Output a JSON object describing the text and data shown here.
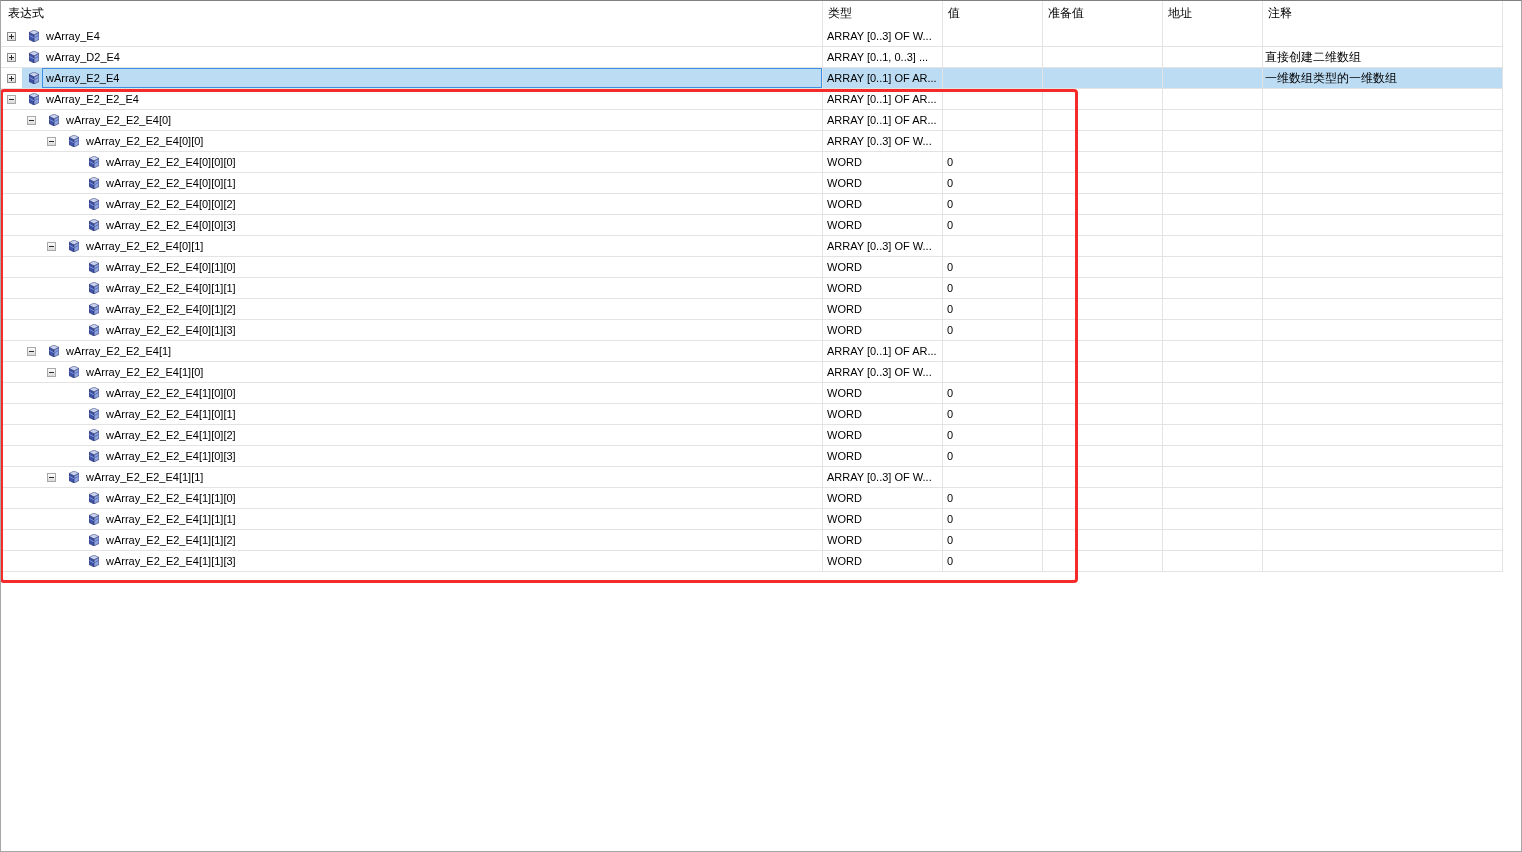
{
  "table": {
    "columns": [
      "表达式",
      "类型",
      "值",
      "准备值",
      "地址",
      "注释"
    ],
    "rows": [
      {
        "name": "wArray_E4",
        "type": "ARRAY [0..3] OF W...",
        "expanded": false,
        "selected": false
      },
      {
        "name": "wArray_D2_E4",
        "type": "ARRAY [0..1, 0..3] ...",
        "comment": "直接创建二维数组",
        "expanded": false,
        "selected": false
      },
      {
        "name": "wArray_E2_E4",
        "type": "ARRAY [0..1] OF AR...",
        "comment": "一维数组类型的一维数组",
        "expanded": false,
        "selected": true
      },
      {
        "name": "wArray_E2_E2_E4",
        "type": "ARRAY [0..1] OF AR...",
        "expanded": true,
        "selected": false,
        "children": [
          {
            "name": "wArray_E2_E2_E4[0]",
            "type": "ARRAY [0..1] OF AR...",
            "expanded": true,
            "selected": false,
            "children": [
              {
                "name": "wArray_E2_E2_E4[0][0]",
                "type": "ARRAY [0..3] OF W...",
                "expanded": true,
                "selected": false,
                "children": [
                  {
                    "name": "wArray_E2_E2_E4[0][0][0]",
                    "type": "WORD",
                    "value": "0",
                    "selected": false
                  },
                  {
                    "name": "wArray_E2_E2_E4[0][0][1]",
                    "type": "WORD",
                    "value": "0",
                    "selected": false
                  },
                  {
                    "name": "wArray_E2_E2_E4[0][0][2]",
                    "type": "WORD",
                    "value": "0",
                    "selected": false
                  },
                  {
                    "name": "wArray_E2_E2_E4[0][0][3]",
                    "type": "WORD",
                    "value": "0",
                    "selected": false
                  }
                ]
              },
              {
                "name": "wArray_E2_E2_E4[0][1]",
                "type": "ARRAY [0..3] OF W...",
                "expanded": true,
                "selected": false,
                "children": [
                  {
                    "name": "wArray_E2_E2_E4[0][1][0]",
                    "type": "WORD",
                    "value": "0",
                    "selected": false
                  },
                  {
                    "name": "wArray_E2_E2_E4[0][1][1]",
                    "type": "WORD",
                    "value": "0",
                    "selected": false
                  },
                  {
                    "name": "wArray_E2_E2_E4[0][1][2]",
                    "type": "WORD",
                    "value": "0",
                    "selected": false
                  },
                  {
                    "name": "wArray_E2_E2_E4[0][1][3]",
                    "type": "WORD",
                    "value": "0",
                    "selected": false
                  }
                ]
              }
            ]
          },
          {
            "name": "wArray_E2_E2_E4[1]",
            "type": "ARRAY [0..1] OF AR...",
            "expanded": true,
            "selected": false,
            "children": [
              {
                "name": "wArray_E2_E2_E4[1][0]",
                "type": "ARRAY [0..3] OF W...",
                "expanded": true,
                "selected": false,
                "children": [
                  {
                    "name": "wArray_E2_E2_E4[1][0][0]",
                    "type": "WORD",
                    "value": "0",
                    "selected": false
                  },
                  {
                    "name": "wArray_E2_E2_E4[1][0][1]",
                    "type": "WORD",
                    "value": "0",
                    "selected": false
                  },
                  {
                    "name": "wArray_E2_E2_E4[1][0][2]",
                    "type": "WORD",
                    "value": "0",
                    "selected": false
                  },
                  {
                    "name": "wArray_E2_E2_E4[1][0][3]",
                    "type": "WORD",
                    "value": "0",
                    "selected": false
                  }
                ]
              },
              {
                "name": "wArray_E2_E2_E4[1][1]",
                "type": "ARRAY [0..3] OF W...",
                "expanded": true,
                "selected": false,
                "children": [
                  {
                    "name": "wArray_E2_E2_E4[1][1][0]",
                    "type": "WORD",
                    "value": "0",
                    "selected": false
                  },
                  {
                    "name": "wArray_E2_E2_E4[1][1][1]",
                    "type": "WORD",
                    "value": "0",
                    "selected": false
                  },
                  {
                    "name": "wArray_E2_E2_E4[1][1][2]",
                    "type": "WORD",
                    "value": "0",
                    "selected": false
                  },
                  {
                    "name": "wArray_E2_E2_E4[1][1][3]",
                    "type": "WORD",
                    "value": "0",
                    "selected": false
                  }
                ]
              }
            ]
          }
        ]
      }
    ]
  }
}
